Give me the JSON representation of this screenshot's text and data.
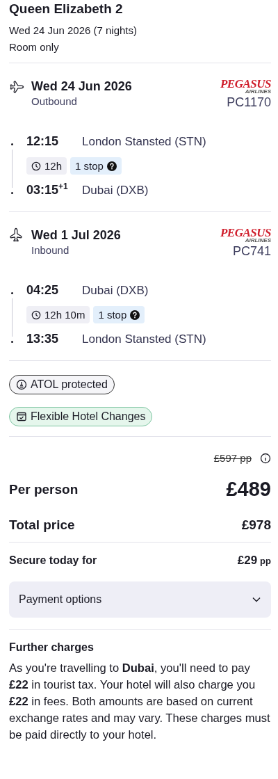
{
  "hotel": {
    "name": "Queen Elizabeth 2",
    "dates": "Wed 24 Jun 2026 (7 nights)",
    "board": "Room only"
  },
  "flights": [
    {
      "kind": "outbound",
      "date": "Wed 24 Jun 2026",
      "label": "Outbound",
      "airline_logo": "PEGASUS",
      "airline_logo_sub": "AIRLINES",
      "flight_number": "PC1170",
      "depart_time": "12:15",
      "depart_airport": "London Stansted (STN)",
      "duration": "12h",
      "stops": "1 stop",
      "arrive_time": "03:15",
      "arrive_day_offset": "+1",
      "arrive_airport": "Dubai (DXB)"
    },
    {
      "kind": "inbound",
      "date": "Wed 1 Jul 2026",
      "label": "Inbound",
      "airline_logo": "PEGASUS",
      "airline_logo_sub": "AIRLINES",
      "flight_number": "PC741",
      "depart_time": "04:25",
      "depart_airport": "Dubai (DXB)",
      "duration": "12h 10m",
      "stops": "1 stop",
      "arrive_time": "13:35",
      "arrive_airport": "London Stansted (STN)"
    }
  ],
  "badges": [
    {
      "kind": "atol",
      "label": "ATOL protected"
    },
    {
      "kind": "flexible",
      "label": "Flexible Hotel Changes"
    }
  ],
  "pricing": {
    "was_price": "£597 pp",
    "per_person_label": "Per person",
    "per_person": "£489",
    "total_label": "Total price",
    "total": "£978",
    "secure_label": "Secure today for",
    "secure_amount": "£29",
    "secure_unit": "pp",
    "payment_options": {
      "label": "Payment options",
      "expanded": false
    }
  },
  "further_charges": {
    "title": "Further charges",
    "text": "As you're travelling to **Dubai**, you'll need to pay **£22** in tourist tax. Your hotel will also charge you **£22** in fees. Both amounts are based on current exchange rates and may vary. These charges must be paid directly to your hotel."
  }
}
